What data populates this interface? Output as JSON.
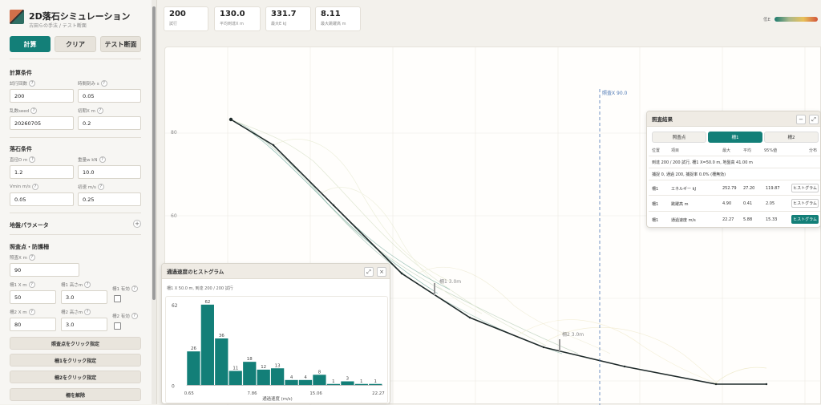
{
  "app": {
    "title": "2D落石シミュレーション",
    "subtitle": "古田らの手法 / テスト断面"
  },
  "actions": {
    "compute": "計算",
    "clear": "クリア",
    "test_section": "テスト断面"
  },
  "calc": {
    "title": "計算条件",
    "trials": {
      "label": "試行回数",
      "value": "200"
    },
    "timestep": {
      "label": "時間刻み s",
      "value": "0.05"
    },
    "seed": {
      "label": "乱数seed",
      "value": "20260705"
    },
    "init_x": {
      "label": "初期X m",
      "value": "0.2"
    }
  },
  "rock": {
    "title": "落石条件",
    "diameter": {
      "label": "直径D m",
      "value": "1.2"
    },
    "weight": {
      "label": "重量w kN",
      "value": "10.0"
    },
    "vmin": {
      "label": "Vmin m/s",
      "value": "0.05"
    },
    "v0": {
      "label": "初速 m/s",
      "value": "0.25"
    }
  },
  "ground": {
    "title": "地盤パラメータ",
    "toggle": "+"
  },
  "check": {
    "title": "照査点・防護柵",
    "x": {
      "label": "照査X m",
      "value": "90"
    },
    "f1x": {
      "label": "柵1 X m",
      "value": "50"
    },
    "f1h": {
      "label": "柵1 高さm",
      "value": "3.0"
    },
    "f1en": {
      "label": "柵1 有効"
    },
    "f2x": {
      "label": "柵2 X m",
      "value": "80"
    },
    "f2h": {
      "label": "柵2 高さm",
      "value": "3.0"
    },
    "f2en": {
      "label": "柵2 有効"
    },
    "btn_check": "照査点をクリック指定",
    "btn_f1": "柵1をクリック指定",
    "btn_f2": "柵2をクリック指定",
    "btn_remove": "柵を解除"
  },
  "stats": [
    {
      "value": "200",
      "label": "試行"
    },
    {
      "value": "130.0",
      "label": "平均到達X m"
    },
    {
      "value": "331.7",
      "label": "最大E kJ"
    },
    {
      "value": "8.11",
      "label": "最大跳躍高 m"
    }
  ],
  "legend": {
    "label": "低E"
  },
  "plot": {
    "y_ticks": [
      "80",
      "60"
    ],
    "check_label": "照査X 90.0",
    "fence1_label": "柵1 3.0m",
    "fence2_label": "柵2 3.0m"
  },
  "results": {
    "title": "照査結果",
    "tabs": [
      "照査点",
      "柵1",
      "柵2"
    ],
    "headers": [
      "位置",
      "項目",
      "最大",
      "平均",
      "95%値",
      "分布"
    ],
    "info1": "到達 200 / 200 試行, 柵1 X=50.0 m, 地盤高 41.00 m",
    "info2": "捕捉 0, 通過 200, 捕捉率 0.0% (柵無効)",
    "rows": [
      {
        "pos": "柵1",
        "item": "エネルギー kJ",
        "max": "252.79",
        "avg": "27.20",
        "p95": "119.87",
        "btn": "ヒストグラム"
      },
      {
        "pos": "柵1",
        "item": "跳躍高 m",
        "max": "4.90",
        "avg": "0.41",
        "p95": "2.05",
        "btn": "ヒストグラム"
      },
      {
        "pos": "柵1",
        "item": "通過速度 m/s",
        "max": "22.27",
        "avg": "5.88",
        "p95": "15.33",
        "btn": "ヒストグラム"
      }
    ]
  },
  "histogram": {
    "title": "通過速度のヒストグラム",
    "info": "柵1 X 50.0 m, 到達 200 / 200 試行",
    "xlabel": "通過速度 (m/s)",
    "x_ticks": [
      "0.65",
      "7.86",
      "15.06",
      "22.27"
    ],
    "y_max_label": "62",
    "y_min_label": "0"
  },
  "chart_data": {
    "type": "bar",
    "title": "通過速度のヒストグラム",
    "xlabel": "通過速度 (m/s)",
    "ylabel": "",
    "x_range": [
      0.65,
      22.27
    ],
    "ylim": [
      0,
      62
    ],
    "values": [
      26,
      62,
      36,
      11,
      18,
      12,
      13,
      4,
      4,
      8,
      1,
      3,
      1,
      1
    ],
    "labels": [
      "26",
      "62",
      "36",
      "11",
      "18",
      "12",
      "13",
      "4",
      "4",
      "8",
      "1",
      "3",
      "1",
      "1"
    ]
  },
  "colors": {
    "accent": "#137f78",
    "profile": "#1f2a2a",
    "check_line": "#4f79b5"
  }
}
